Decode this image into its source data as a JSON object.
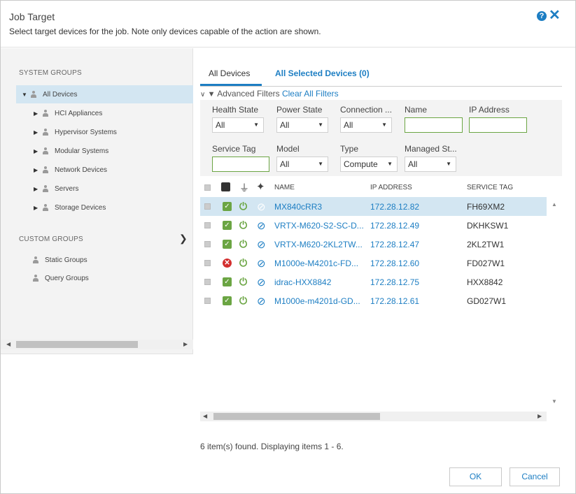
{
  "dialog": {
    "title": "Job Target",
    "subtitle": "Select target devices for the job. Note only devices capable of the action are shown.",
    "help_icon": "?",
    "close_icon": "✕"
  },
  "left_panel": {
    "system_groups_heading": "SYSTEM GROUPS",
    "root": "All Devices",
    "system_groups": [
      "HCI Appliances",
      "Hypervisor Systems",
      "Modular Systems",
      "Network Devices",
      "Servers",
      "Storage Devices"
    ],
    "custom_groups_heading": "CUSTOM GROUPS",
    "custom_groups": [
      "Static Groups",
      "Query Groups"
    ]
  },
  "tabs": {
    "all_devices": "All Devices",
    "all_selected": "All Selected Devices (0)"
  },
  "filters": {
    "advanced_label": "Advanced Filters",
    "clear_label": "Clear All Filters",
    "health_state": {
      "label": "Health State",
      "value": "All"
    },
    "power_state": {
      "label": "Power State",
      "value": "All"
    },
    "connection": {
      "label": "Connection ...",
      "value": "All"
    },
    "name": {
      "label": "Name",
      "value": ""
    },
    "ip_address": {
      "label": "IP Address",
      "value": ""
    },
    "service_tag": {
      "label": "Service Tag",
      "value": ""
    },
    "model": {
      "label": "Model",
      "value": "All"
    },
    "type": {
      "label": "Type",
      "value": "Compute"
    },
    "managed_state": {
      "label": "Managed St...",
      "value": "All"
    }
  },
  "table": {
    "columns": {
      "name": "NAME",
      "ip": "IP ADDRESS",
      "tag": "SERVICE TAG"
    },
    "rows": [
      {
        "health": "ok",
        "name": "MX840cRR3",
        "ip": "172.28.12.82",
        "tag": "FH69XM2"
      },
      {
        "health": "ok",
        "name": "VRTX-M620-S2-SC-D...",
        "ip": "172.28.12.49",
        "tag": "DKHKSW1"
      },
      {
        "health": "ok",
        "name": "VRTX-M620-2KL2TW...",
        "ip": "172.28.12.47",
        "tag": "2KL2TW1"
      },
      {
        "health": "critical",
        "name": "M1000e-M4201c-FD...",
        "ip": "172.28.12.60",
        "tag": "FD027W1"
      },
      {
        "health": "ok",
        "name": "idrac-HXX8842",
        "ip": "172.28.12.75",
        "tag": "HXX8842"
      },
      {
        "health": "ok",
        "name": "M1000e-m4201d-GD...",
        "ip": "172.28.12.61",
        "tag": "GD027W1"
      }
    ]
  },
  "footer": {
    "found_text": "6 item(s) found. Displaying items 1 - 6.",
    "ok_label": "OK",
    "cancel_label": "Cancel"
  },
  "colors": {
    "accent": "#1d7ec3",
    "ok": "#6ba543",
    "critical": "#d32f2f",
    "selected_row": "#d3e6f2"
  },
  "icons": {
    "health_column": "health-icon",
    "power_column": "plug-icon",
    "connection_column": "connection-icon"
  }
}
